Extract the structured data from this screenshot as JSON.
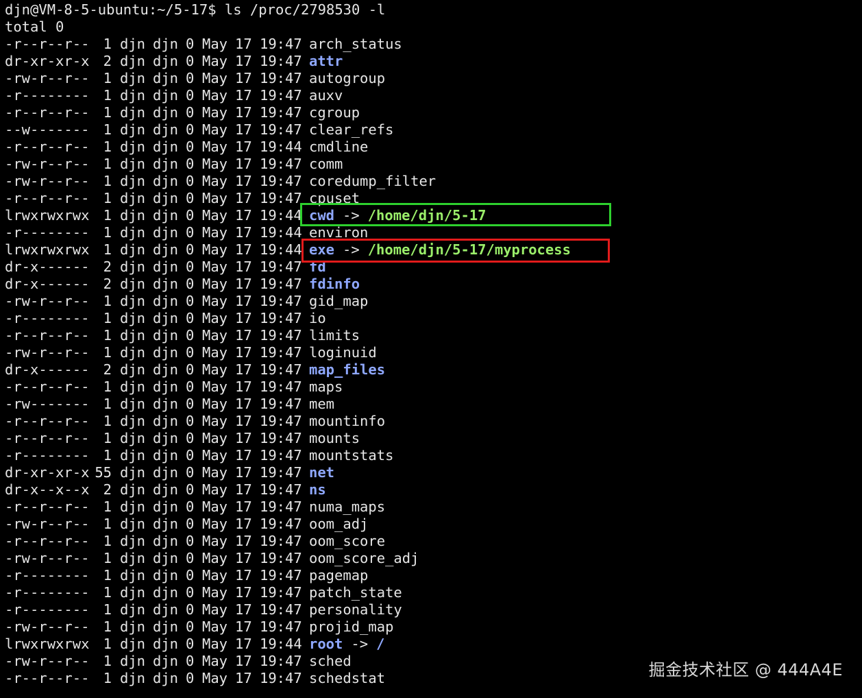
{
  "prompt": "djn@VM-8-5-ubuntu:~/5-17$ ls /proc/2798530 -l",
  "total_line": "total 0",
  "entries": [
    {
      "perm": "-r--r--r--",
      "links": "1",
      "user": "djn",
      "group": "djn",
      "size": "0",
      "month": "May",
      "day": "17",
      "time": "19:47",
      "name": "arch_status",
      "type": "file"
    },
    {
      "perm": "dr-xr-xr-x",
      "links": "2",
      "user": "djn",
      "group": "djn",
      "size": "0",
      "month": "May",
      "day": "17",
      "time": "19:47",
      "name": "attr",
      "type": "dir"
    },
    {
      "perm": "-rw-r--r--",
      "links": "1",
      "user": "djn",
      "group": "djn",
      "size": "0",
      "month": "May",
      "day": "17",
      "time": "19:47",
      "name": "autogroup",
      "type": "file"
    },
    {
      "perm": "-r--------",
      "links": "1",
      "user": "djn",
      "group": "djn",
      "size": "0",
      "month": "May",
      "day": "17",
      "time": "19:47",
      "name": "auxv",
      "type": "file"
    },
    {
      "perm": "-r--r--r--",
      "links": "1",
      "user": "djn",
      "group": "djn",
      "size": "0",
      "month": "May",
      "day": "17",
      "time": "19:47",
      "name": "cgroup",
      "type": "file"
    },
    {
      "perm": "--w-------",
      "links": "1",
      "user": "djn",
      "group": "djn",
      "size": "0",
      "month": "May",
      "day": "17",
      "time": "19:47",
      "name": "clear_refs",
      "type": "file"
    },
    {
      "perm": "-r--r--r--",
      "links": "1",
      "user": "djn",
      "group": "djn",
      "size": "0",
      "month": "May",
      "day": "17",
      "time": "19:44",
      "name": "cmdline",
      "type": "file"
    },
    {
      "perm": "-rw-r--r--",
      "links": "1",
      "user": "djn",
      "group": "djn",
      "size": "0",
      "month": "May",
      "day": "17",
      "time": "19:47",
      "name": "comm",
      "type": "file"
    },
    {
      "perm": "-rw-r--r--",
      "links": "1",
      "user": "djn",
      "group": "djn",
      "size": "0",
      "month": "May",
      "day": "17",
      "time": "19:47",
      "name": "coredump_filter",
      "type": "file"
    },
    {
      "perm": "-r--r--r--",
      "links": "1",
      "user": "djn",
      "group": "djn",
      "size": "0",
      "month": "May",
      "day": "17",
      "time": "19:47",
      "name": "cpuset",
      "type": "file"
    },
    {
      "perm": "lrwxrwxrwx",
      "links": "1",
      "user": "djn",
      "group": "djn",
      "size": "0",
      "month": "May",
      "day": "17",
      "time": "19:44",
      "name": "cwd",
      "type": "link",
      "arrow": "->",
      "target": "/home/djn/5-17"
    },
    {
      "perm": "-r--------",
      "links": "1",
      "user": "djn",
      "group": "djn",
      "size": "0",
      "month": "May",
      "day": "17",
      "time": "19:44",
      "name": "environ",
      "type": "file"
    },
    {
      "perm": "lrwxrwxrwx",
      "links": "1",
      "user": "djn",
      "group": "djn",
      "size": "0",
      "month": "May",
      "day": "17",
      "time": "19:44",
      "name": "exe",
      "type": "link",
      "arrow": "->",
      "target": "/home/djn/5-17/myprocess"
    },
    {
      "perm": "dr-x------",
      "links": "2",
      "user": "djn",
      "group": "djn",
      "size": "0",
      "month": "May",
      "day": "17",
      "time": "19:47",
      "name": "fd",
      "type": "dir"
    },
    {
      "perm": "dr-x------",
      "links": "2",
      "user": "djn",
      "group": "djn",
      "size": "0",
      "month": "May",
      "day": "17",
      "time": "19:47",
      "name": "fdinfo",
      "type": "dir"
    },
    {
      "perm": "-rw-r--r--",
      "links": "1",
      "user": "djn",
      "group": "djn",
      "size": "0",
      "month": "May",
      "day": "17",
      "time": "19:47",
      "name": "gid_map",
      "type": "file"
    },
    {
      "perm": "-r--------",
      "links": "1",
      "user": "djn",
      "group": "djn",
      "size": "0",
      "month": "May",
      "day": "17",
      "time": "19:47",
      "name": "io",
      "type": "file"
    },
    {
      "perm": "-r--r--r--",
      "links": "1",
      "user": "djn",
      "group": "djn",
      "size": "0",
      "month": "May",
      "day": "17",
      "time": "19:47",
      "name": "limits",
      "type": "file"
    },
    {
      "perm": "-rw-r--r--",
      "links": "1",
      "user": "djn",
      "group": "djn",
      "size": "0",
      "month": "May",
      "day": "17",
      "time": "19:47",
      "name": "loginuid",
      "type": "file"
    },
    {
      "perm": "dr-x------",
      "links": "2",
      "user": "djn",
      "group": "djn",
      "size": "0",
      "month": "May",
      "day": "17",
      "time": "19:47",
      "name": "map_files",
      "type": "dir"
    },
    {
      "perm": "-r--r--r--",
      "links": "1",
      "user": "djn",
      "group": "djn",
      "size": "0",
      "month": "May",
      "day": "17",
      "time": "19:47",
      "name": "maps",
      "type": "file"
    },
    {
      "perm": "-rw-------",
      "links": "1",
      "user": "djn",
      "group": "djn",
      "size": "0",
      "month": "May",
      "day": "17",
      "time": "19:47",
      "name": "mem",
      "type": "file"
    },
    {
      "perm": "-r--r--r--",
      "links": "1",
      "user": "djn",
      "group": "djn",
      "size": "0",
      "month": "May",
      "day": "17",
      "time": "19:47",
      "name": "mountinfo",
      "type": "file"
    },
    {
      "perm": "-r--r--r--",
      "links": "1",
      "user": "djn",
      "group": "djn",
      "size": "0",
      "month": "May",
      "day": "17",
      "time": "19:47",
      "name": "mounts",
      "type": "file"
    },
    {
      "perm": "-r--------",
      "links": "1",
      "user": "djn",
      "group": "djn",
      "size": "0",
      "month": "May",
      "day": "17",
      "time": "19:47",
      "name": "mountstats",
      "type": "file"
    },
    {
      "perm": "dr-xr-xr-x",
      "links": "55",
      "user": "djn",
      "group": "djn",
      "size": "0",
      "month": "May",
      "day": "17",
      "time": "19:47",
      "name": "net",
      "type": "dir"
    },
    {
      "perm": "dr-x--x--x",
      "links": "2",
      "user": "djn",
      "group": "djn",
      "size": "0",
      "month": "May",
      "day": "17",
      "time": "19:47",
      "name": "ns",
      "type": "dir"
    },
    {
      "perm": "-r--r--r--",
      "links": "1",
      "user": "djn",
      "group": "djn",
      "size": "0",
      "month": "May",
      "day": "17",
      "time": "19:47",
      "name": "numa_maps",
      "type": "file"
    },
    {
      "perm": "-rw-r--r--",
      "links": "1",
      "user": "djn",
      "group": "djn",
      "size": "0",
      "month": "May",
      "day": "17",
      "time": "19:47",
      "name": "oom_adj",
      "type": "file"
    },
    {
      "perm": "-r--r--r--",
      "links": "1",
      "user": "djn",
      "group": "djn",
      "size": "0",
      "month": "May",
      "day": "17",
      "time": "19:47",
      "name": "oom_score",
      "type": "file"
    },
    {
      "perm": "-rw-r--r--",
      "links": "1",
      "user": "djn",
      "group": "djn",
      "size": "0",
      "month": "May",
      "day": "17",
      "time": "19:47",
      "name": "oom_score_adj",
      "type": "file"
    },
    {
      "perm": "-r--------",
      "links": "1",
      "user": "djn",
      "group": "djn",
      "size": "0",
      "month": "May",
      "day": "17",
      "time": "19:47",
      "name": "pagemap",
      "type": "file"
    },
    {
      "perm": "-r--------",
      "links": "1",
      "user": "djn",
      "group": "djn",
      "size": "0",
      "month": "May",
      "day": "17",
      "time": "19:47",
      "name": "patch_state",
      "type": "file"
    },
    {
      "perm": "-r--------",
      "links": "1",
      "user": "djn",
      "group": "djn",
      "size": "0",
      "month": "May",
      "day": "17",
      "time": "19:47",
      "name": "personality",
      "type": "file"
    },
    {
      "perm": "-rw-r--r--",
      "links": "1",
      "user": "djn",
      "group": "djn",
      "size": "0",
      "month": "May",
      "day": "17",
      "time": "19:47",
      "name": "projid_map",
      "type": "file"
    },
    {
      "perm": "lrwxrwxrwx",
      "links": "1",
      "user": "djn",
      "group": "djn",
      "size": "0",
      "month": "May",
      "day": "17",
      "time": "19:44",
      "name": "root",
      "type": "link-root",
      "arrow": "->",
      "target": "/"
    },
    {
      "perm": "-rw-r--r--",
      "links": "1",
      "user": "djn",
      "group": "djn",
      "size": "0",
      "month": "May",
      "day": "17",
      "time": "19:47",
      "name": "sched",
      "type": "file"
    },
    {
      "perm": "-r--r--r--",
      "links": "1",
      "user": "djn",
      "group": "djn",
      "size": "0",
      "month": "May",
      "day": "17",
      "time": "19:47",
      "name": "schedstat",
      "type": "file"
    }
  ],
  "highlights": {
    "green_color": "#2ed12e",
    "red_color": "#e21b1b"
  },
  "colors": {
    "background": "#000000",
    "text": "#e6e6e6",
    "directory": "#8fa8ff",
    "symlink_target": "#9bee6a"
  },
  "watermark": "掘金技术社区 @ 444A4E"
}
